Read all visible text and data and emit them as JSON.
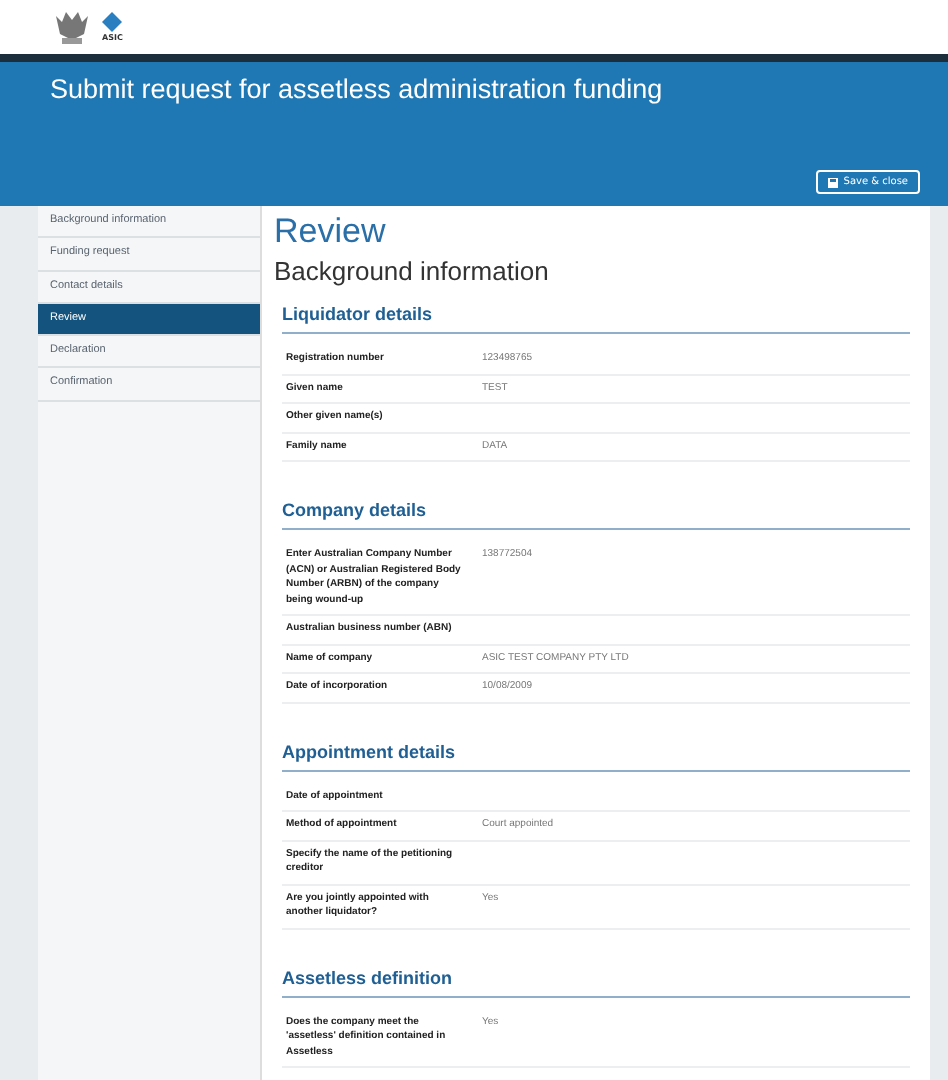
{
  "header": {
    "logo_text": "ASIC"
  },
  "banner": {
    "title": "Submit request for assetless administration funding",
    "save_button": "Save & close"
  },
  "sidebar": {
    "items": [
      {
        "label": "Background information",
        "selected": false
      },
      {
        "label": "Funding request",
        "selected": false
      },
      {
        "label": "Contact details",
        "selected": false
      },
      {
        "label": "Review",
        "selected": true
      },
      {
        "label": "Declaration",
        "selected": false
      },
      {
        "label": "Confirmation",
        "selected": false
      }
    ]
  },
  "main": {
    "title": "Review",
    "subtitle": "Background information",
    "sections": [
      {
        "heading": "Liquidator details",
        "rows": [
          {
            "label": "Registration number",
            "value": "123498765"
          },
          {
            "label": "Given name",
            "value": "TEST"
          },
          {
            "label": "Other given name(s)"
          },
          {
            "label": "Family name",
            "value": "DATA"
          }
        ]
      },
      {
        "heading": "Company details",
        "rows": [
          {
            "label": "Enter Australian Company Number (ACN) or Australian Registered Body Number (ARBN) of the company being wound-up",
            "value": "138772504"
          },
          {
            "label": "Australian business number (ABN)"
          },
          {
            "label": "Name of company",
            "value": "ASIC TEST COMPANY PTY LTD"
          },
          {
            "label": "Date of incorporation",
            "value": "10/08/2009"
          }
        ]
      },
      {
        "heading": "Appointment details",
        "rows": [
          {
            "label": "Date of appointment"
          },
          {
            "label": "Method of appointment",
            "value": "Court appointed"
          },
          {
            "label": "Specify the name of the petitioning creditor"
          },
          {
            "label": "Are you jointly appointed with another liquidator?",
            "value": "Yes"
          }
        ]
      },
      {
        "heading": "Assetless definition",
        "rows": [
          {
            "label": "Does the company meet the 'assetless' definition contained in Assetless",
            "value": "Yes"
          }
        ]
      }
    ]
  }
}
